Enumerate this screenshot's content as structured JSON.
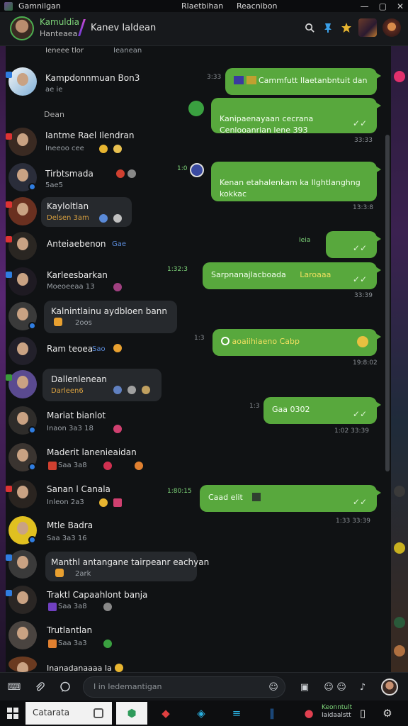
{
  "titlebar": {
    "app_name": "Gamnilgan",
    "center_left": "Rlaetbihan",
    "center_right": "Reacnibon",
    "minimize": "—",
    "maximize": "▢",
    "close": "✕"
  },
  "header": {
    "user_name": "Kamuldia",
    "user_sub": "Hanteaea",
    "chat_title": "Kanev Ialdean"
  },
  "messages_left": [
    {
      "name": "Ieneee tlor",
      "meta": "Ieanean"
    },
    {
      "name": "Kampdonnmuan  Bon3",
      "meta": "ae ie"
    },
    {
      "name": "Dean",
      "meta": ""
    },
    {
      "name": "Iantme Rael Ilendran",
      "meta": "Ineeoo cee"
    },
    {
      "name": "Tirbtsmada",
      "meta": "5ae5"
    },
    {
      "name": "Kayloltlan",
      "meta": "Delsen 3am"
    },
    {
      "name": "Anteiaebenon",
      "meta": "Gae"
    },
    {
      "name": "Karleesbarkan",
      "meta": "Moeoeeaa  13"
    },
    {
      "name": "Kalnintlainu  aydbloen bann",
      "meta": "2oos"
    },
    {
      "name": "Ram teoea",
      "meta": "Sao"
    },
    {
      "name": "Dallenlenean",
      "meta": "Darleen6"
    },
    {
      "name": "Mariat bianlot",
      "meta": "Inaon 3a3  18"
    },
    {
      "name": "Maderit lanenieaidan",
      "meta": "Saa 3a8"
    },
    {
      "name": "Sanan l Canala",
      "meta": "Inleon 2a3"
    },
    {
      "name": "Mtle Badra",
      "meta": "Saa 3a3  16"
    },
    {
      "name": "Manthl antangane  tairpeanr eachyan",
      "meta": "2ark"
    },
    {
      "name": "Traktl Capaahlont banja",
      "meta": "Saa 3a8"
    },
    {
      "name": "Trutlantlan",
      "meta": "Saa 3a3"
    },
    {
      "name": "Inanadanaaaa Ia",
      "meta": ""
    }
  ],
  "messages_right": [
    {
      "text": "Cammfutt  Ilaetanbntuit dan",
      "time_left": "3:33",
      "time_below": ""
    },
    {
      "text": "Kanipaenayaan cecrana\nCenlooanrian lene 393",
      "time_left": "",
      "time_below": "33:33"
    },
    {
      "text": "Kenan etahalenkam ka Ilghtlanghng\nkokkac",
      "time_left": "1:0",
      "time_below": "13:3:8"
    },
    {
      "text": "",
      "time_left": "Ieia",
      "time_below": ""
    },
    {
      "text": "Sarpnanajlacboada",
      "time_left": "1:32:3",
      "time_below": "33:39"
    },
    {
      "text": "aoaiihiaeno  Cabp",
      "time_left": "1:3",
      "time_below": "19:8:02"
    },
    {
      "text": "Gaa 0302",
      "time_left": "1:3",
      "time_below": "1:02 33:39"
    },
    {
      "text": "Caad elit",
      "time_left": "1:80:15",
      "time_below": "1:33 33:39"
    }
  ],
  "inline_labels": {
    "bubble5_highlight": "Laroaaa"
  },
  "input": {
    "placeholder": "I in Iedemantigan"
  },
  "taskbar": {
    "search_text": "Catarata",
    "tray_top": "Keonntult",
    "tray_bottom": "Iaidaalstt"
  },
  "colors": {
    "bubble": "#58a83d",
    "accent_green": "#7fd77a",
    "background": "#101214"
  },
  "icons": [
    "search-icon",
    "pin-icon",
    "star-icon",
    "attach-icon",
    "mic-icon",
    "emoji-icon",
    "send-icon",
    "windows-start-icon"
  ]
}
